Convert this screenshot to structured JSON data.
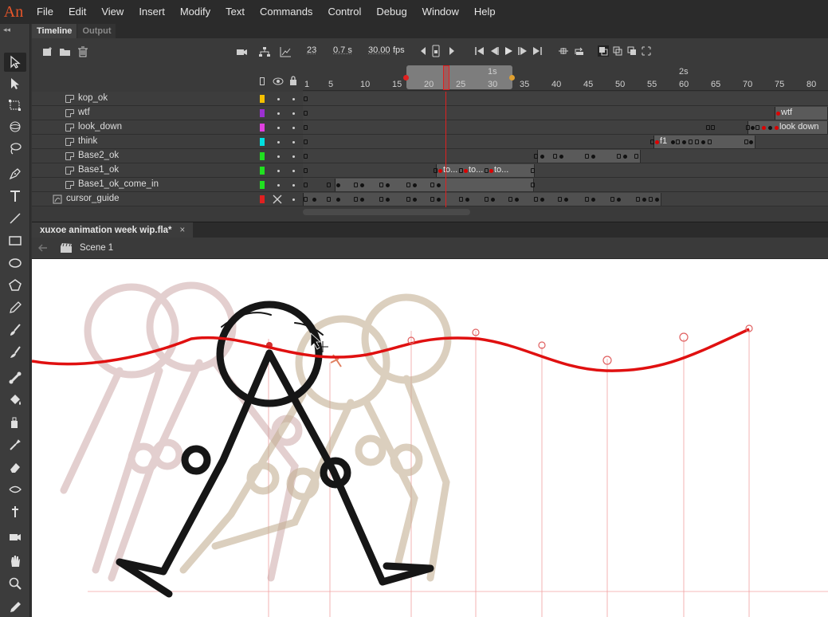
{
  "app": {
    "logo": "An"
  },
  "menu": [
    "File",
    "Edit",
    "View",
    "Insert",
    "Modify",
    "Text",
    "Commands",
    "Control",
    "Debug",
    "Window",
    "Help"
  ],
  "panel_tabs": [
    "Timeline",
    "Output"
  ],
  "timeline": {
    "current_frame": "23",
    "elapsed": "0.7 s",
    "fps": "30.00",
    "fps_unit": "fps",
    "ruler_seconds": [
      "1s",
      "2s"
    ],
    "ruler_frames": [
      "1",
      "5",
      "10",
      "15",
      "20",
      "25",
      "30",
      "35",
      "40",
      "45",
      "50",
      "55",
      "60",
      "65",
      "70",
      "75",
      "80"
    ],
    "layers": [
      {
        "name": "kop_ok",
        "color": "#f5c000",
        "indent": 1
      },
      {
        "name": "wtf",
        "color": "#9b30d0",
        "indent": 1
      },
      {
        "name": "look_down",
        "color": "#e040e0",
        "indent": 1
      },
      {
        "name": "think",
        "color": "#00e0e0",
        "indent": 1
      },
      {
        "name": "Base2_ok",
        "color": "#20e020",
        "indent": 1
      },
      {
        "name": "Base1_ok",
        "color": "#20e020",
        "indent": 1
      },
      {
        "name": "Base1_ok_come_in",
        "color": "#20e020",
        "indent": 1
      },
      {
        "name": "cursor_guide",
        "color": "#e02020",
        "indent": 0
      }
    ],
    "frame_labels": [
      "wtf",
      "look down",
      "f1",
      "to...",
      "to...",
      "to..."
    ]
  },
  "document": {
    "tab_title": "xuxoe animation week wip.fla*",
    "close_glyph": "×",
    "scene": "Scene 1"
  },
  "colors": {
    "accent": "#e8562a",
    "guide_path": "#e01010",
    "playhead": "#e02020"
  }
}
